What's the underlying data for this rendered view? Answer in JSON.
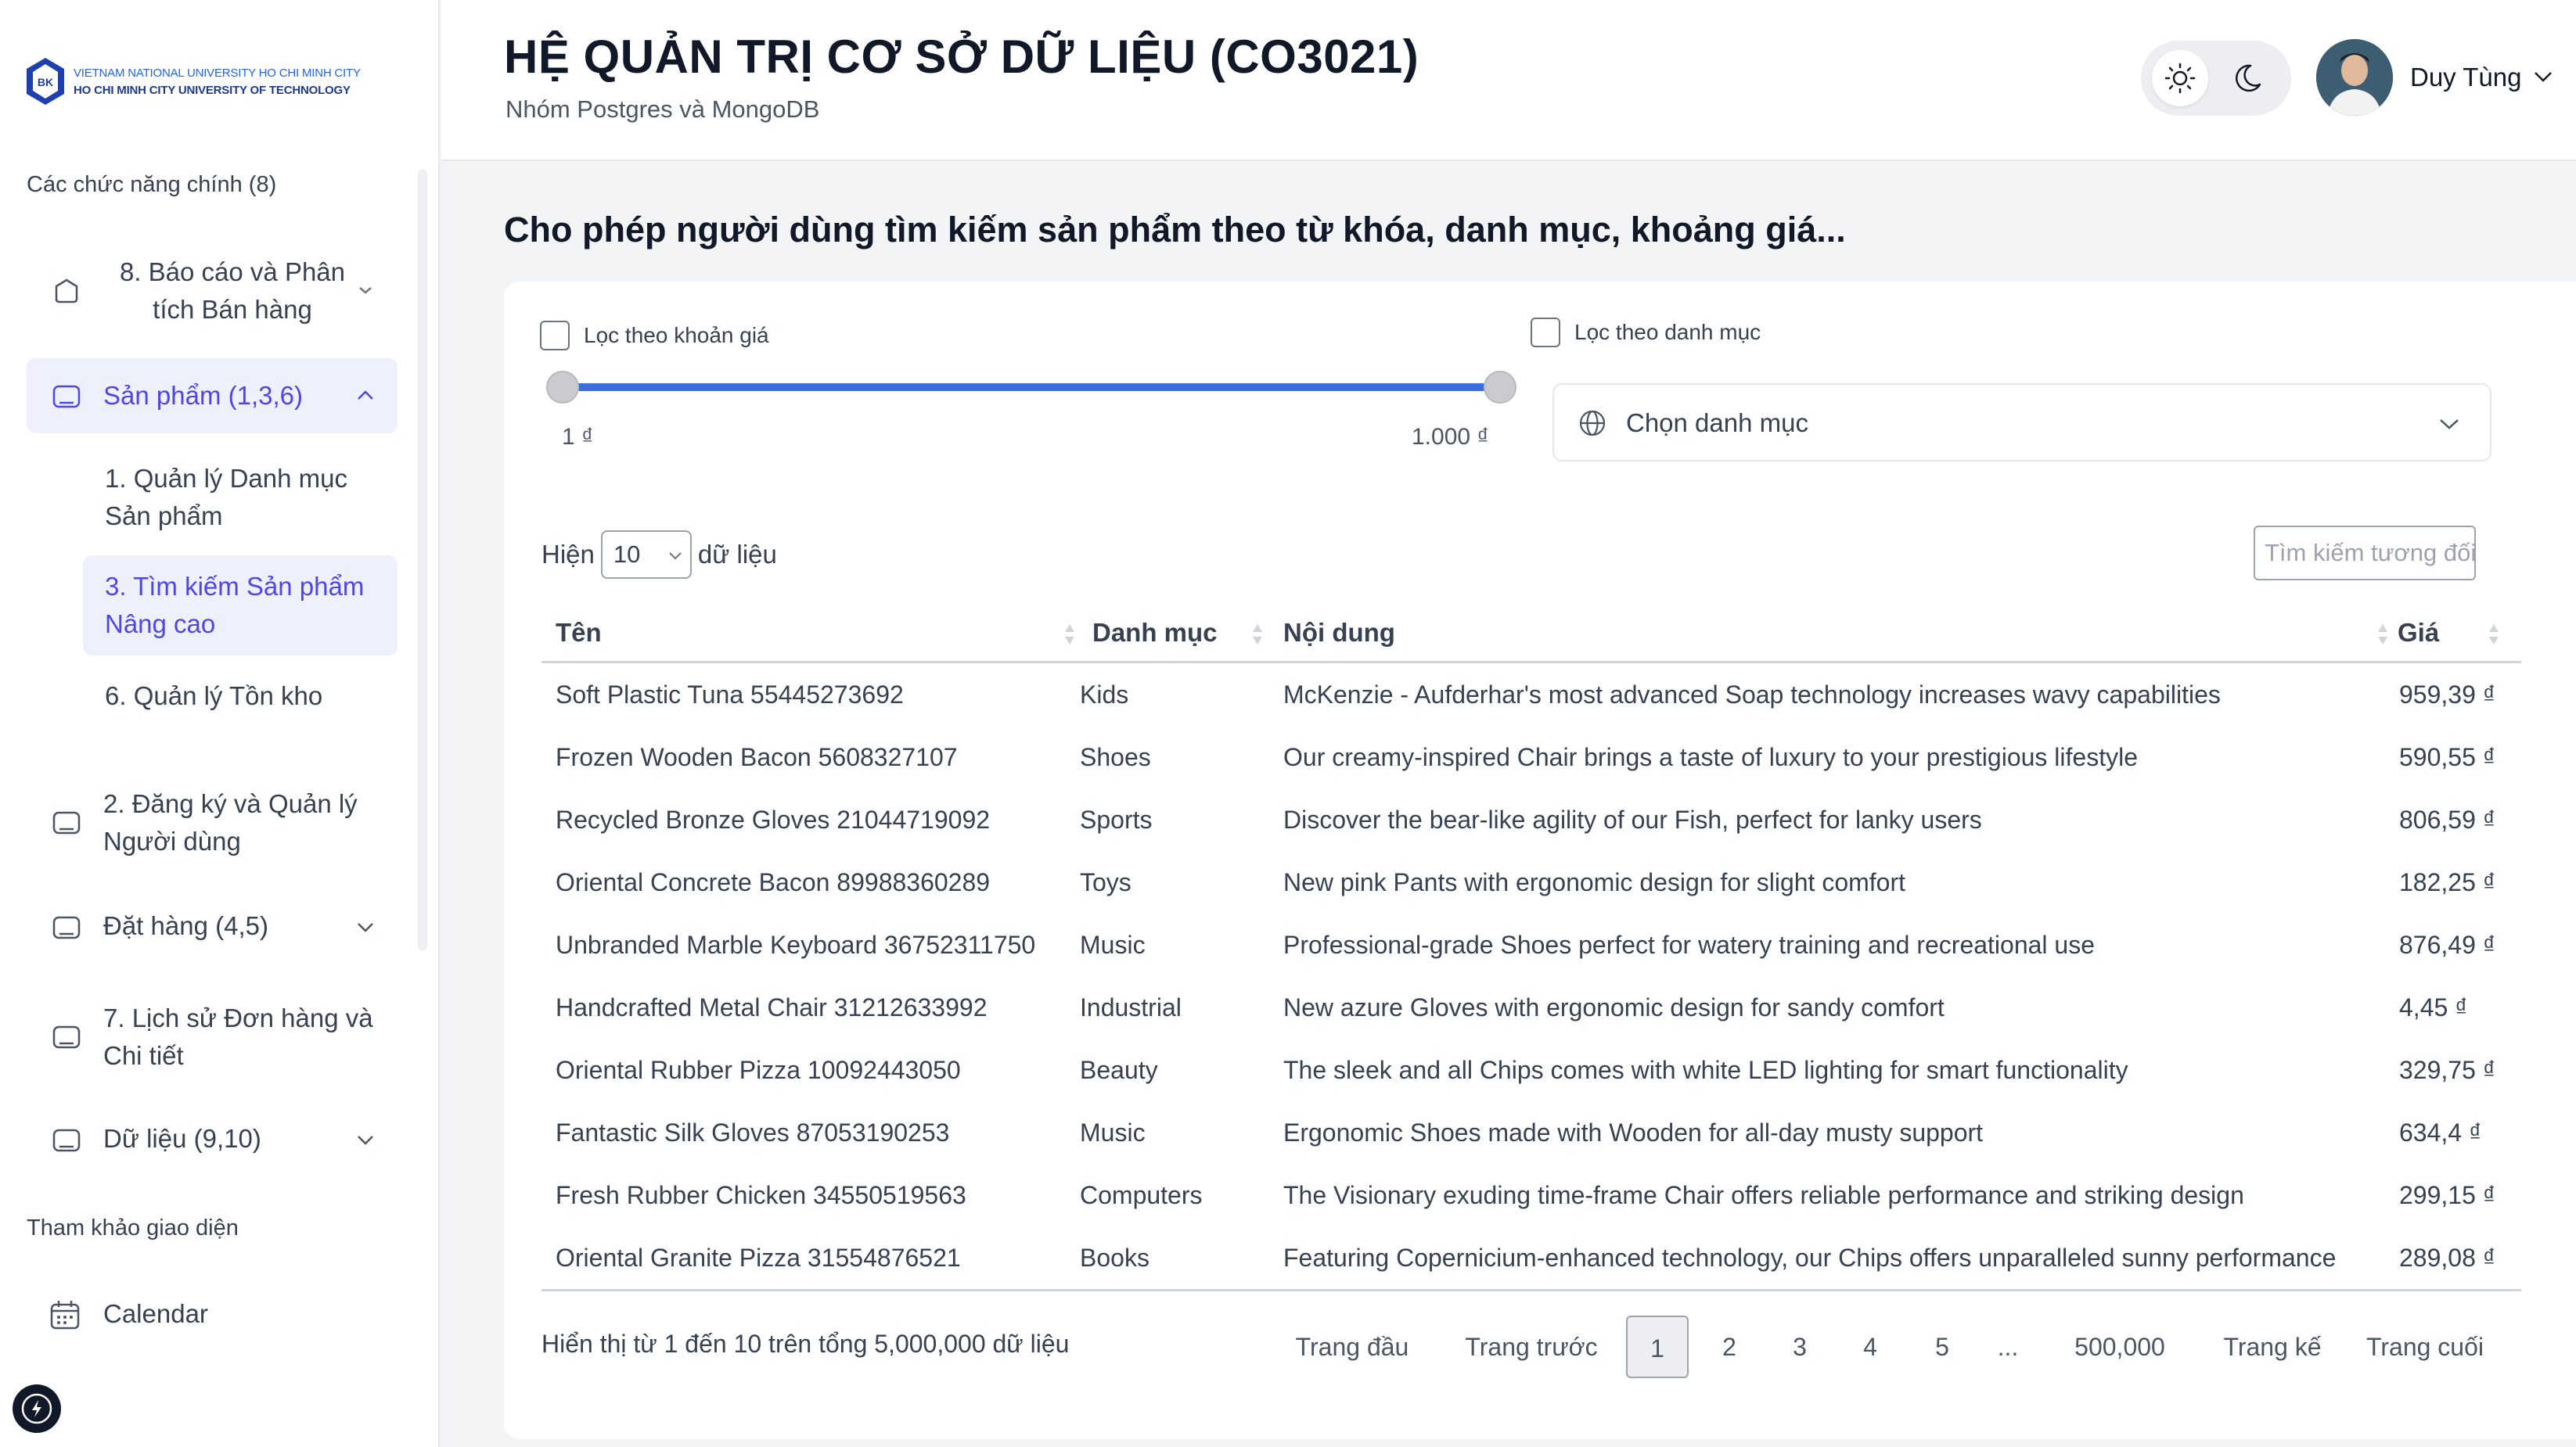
{
  "sidebar": {
    "logo": {
      "line1": "VIETNAM NATIONAL UNIVERSITY HO CHI MINH CITY",
      "line2": "HO CHI MINH CITY UNIVERSITY OF TECHNOLOGY",
      "mark": "BK"
    },
    "section_main": "Các chức năng chính (8)",
    "items": [
      {
        "label": "8. Báo cáo và Phân tích Bán hàng",
        "icon": "box-icon"
      },
      {
        "label": "Sản phẩm (1,3,6)",
        "icon": "box-icon"
      },
      {
        "label": "2. Đăng ký và Quản lý Người dùng",
        "icon": "box-icon"
      },
      {
        "label": "Đặt hàng (4,5)",
        "icon": "box-icon"
      },
      {
        "label": "7. Lịch sử Đơn hàng và Chi tiết",
        "icon": "box-icon"
      },
      {
        "label": "Dữ liệu (9,10)",
        "icon": "box-icon"
      }
    ],
    "subitems": [
      {
        "label": "1. Quản lý Danh mục Sản phẩm"
      },
      {
        "label": "3. Tìm kiếm Sản phẩm Nâng cao"
      },
      {
        "label": "6. Quản lý Tồn kho"
      }
    ],
    "section_ref": "Tham khảo giao diện",
    "ref_items": [
      {
        "label": "Calendar",
        "icon": "calendar-icon"
      }
    ]
  },
  "header": {
    "title": "HỆ QUẢN TRỊ CƠ SỞ DỮ LIỆU (CO3021)",
    "subtitle": "Nhóm Postgres và MongoDB",
    "username": "Duy Tùng"
  },
  "main": {
    "heading": "Cho phép người dùng tìm kiếm sản phẩm theo từ khóa, danh mục, khoảng giá...",
    "price_filter_label": "Lọc theo khoản giá",
    "category_filter_label": "Lọc theo danh mục",
    "price_min": "1 ₫",
    "price_max": "1.000 ₫",
    "category_placeholder": "Chọn danh mục",
    "show_prefix": "Hiện",
    "page_size": "10",
    "show_suffix": "dữ liệu",
    "search_placeholder": "Tìm kiếm tương đối th",
    "columns": [
      "Tên",
      "Danh mục",
      "Nội dung",
      "Giá"
    ],
    "rows": [
      [
        "Soft Plastic Tuna 55445273692",
        "Kids",
        "McKenzie - Aufderhar's most advanced Soap technology increases wavy capabilities",
        "959,39 ₫"
      ],
      [
        "Frozen Wooden Bacon 5608327107",
        "Shoes",
        "Our creamy-inspired Chair brings a taste of luxury to your prestigious lifestyle",
        "590,55 ₫"
      ],
      [
        "Recycled Bronze Gloves 21044719092",
        "Sports",
        "Discover the bear-like agility of our Fish, perfect for lanky users",
        "806,59 ₫"
      ],
      [
        "Oriental Concrete Bacon 89988360289",
        "Toys",
        "New pink Pants with ergonomic design for slight comfort",
        "182,25 ₫"
      ],
      [
        "Unbranded Marble Keyboard 36752311750",
        "Music",
        "Professional-grade Shoes perfect for watery training and recreational use",
        "876,49 ₫"
      ],
      [
        "Handcrafted Metal Chair 31212633992",
        "Industrial",
        "New azure Gloves with ergonomic design for sandy comfort",
        "4,45 ₫"
      ],
      [
        "Oriental Rubber Pizza 10092443050",
        "Beauty",
        "The sleek and all Chips comes with white LED lighting for smart functionality",
        "329,75 ₫"
      ],
      [
        "Fantastic Silk Gloves 87053190253",
        "Music",
        "Ergonomic Shoes made with Wooden for all-day musty support",
        "634,4 ₫"
      ],
      [
        "Fresh Rubber Chicken 34550519563",
        "Computers",
        "The Visionary exuding time-frame Chair offers reliable performance and striking design",
        "299,15 ₫"
      ],
      [
        "Oriental Granite Pizza 31554876521",
        "Books",
        "Featuring Copernicium-enhanced technology, our Chips offers unparalleled sunny performance",
        "289,08 ₫"
      ]
    ],
    "footer_info": "Hiển thị từ 1 đến 10 trên tổng 5,000,000 dữ liệu",
    "pagination": {
      "first": "Trang đầu",
      "prev": "Trang trước",
      "pages": [
        "1",
        "2",
        "3",
        "4",
        "5",
        "...",
        "500,000"
      ],
      "next": "Trang kế",
      "last": "Trang cuối",
      "current": "1"
    }
  },
  "colors": {
    "accent": "#4f46e5",
    "slider": "#3b6fe0",
    "active_bg": "#eef1fb"
  }
}
